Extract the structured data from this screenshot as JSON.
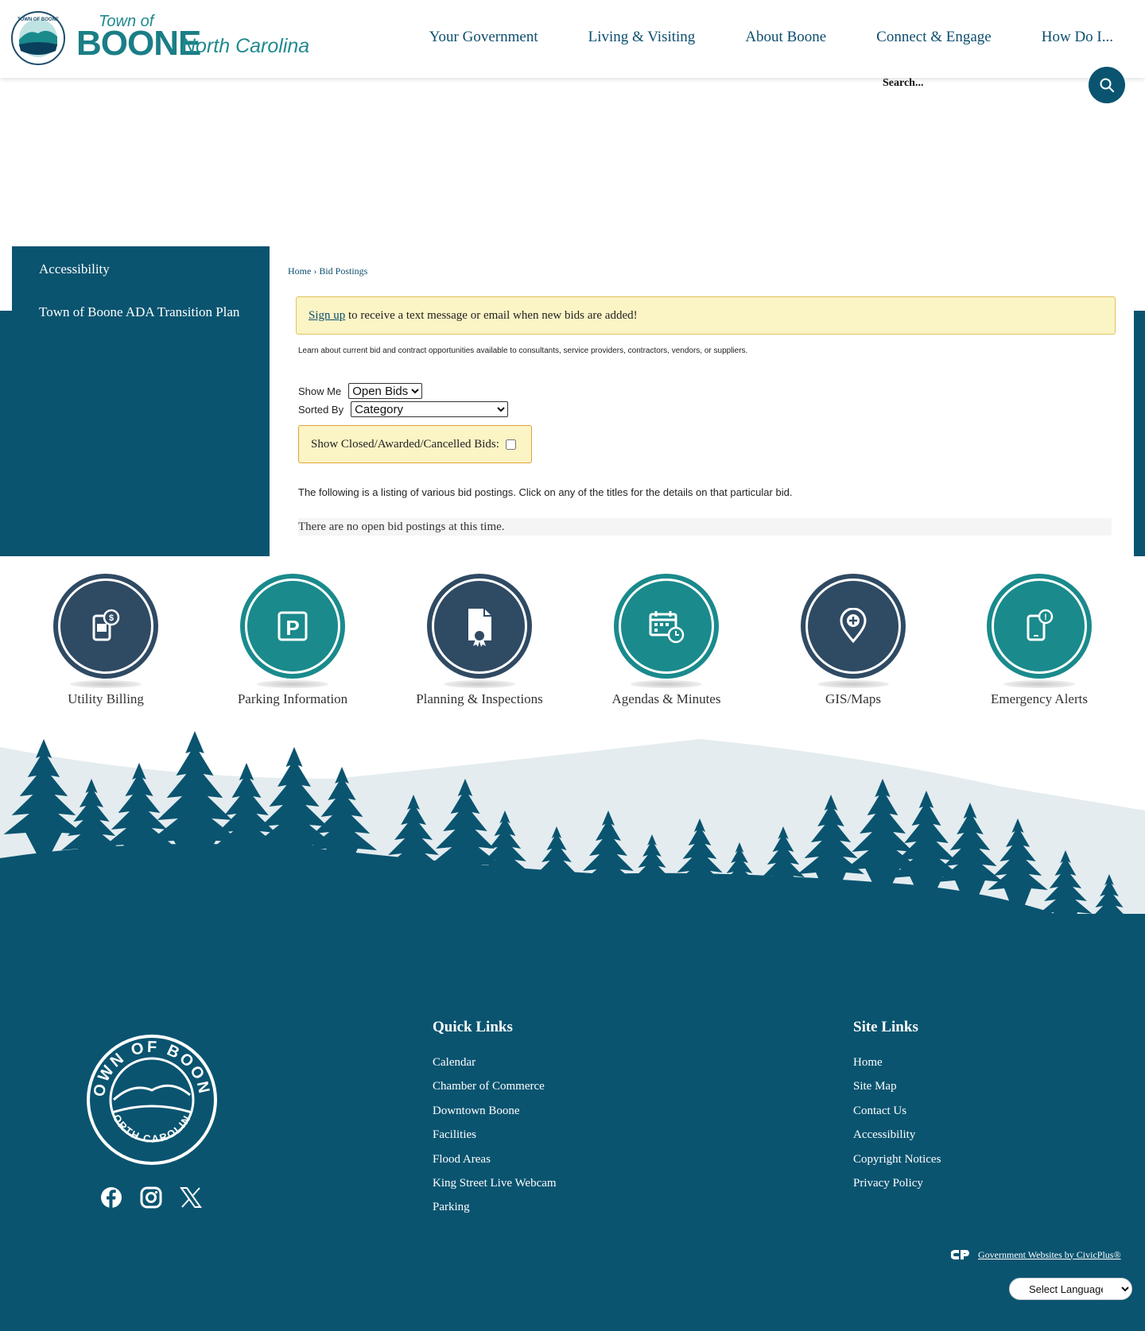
{
  "header": {
    "logo": {
      "town_of": "Town of",
      "boone": "BOONE",
      "state": "North Carolina"
    },
    "nav": [
      "Your Government",
      "Living & Visiting",
      "About Boone",
      "Connect & Engage",
      "How Do I..."
    ]
  },
  "search": {
    "placeholder": "Search..."
  },
  "sidebar": {
    "items": [
      "Accessibility",
      "Town of Boone ADA Transition Plan"
    ]
  },
  "main": {
    "breadcrumb": {
      "home": "Home",
      "separator": "›",
      "current": "Bid Postings"
    },
    "signup": {
      "link": "Sign up",
      "text": " to receive a text message or email when new bids are added!"
    },
    "intro": "Learn about current bid and contract opportunities available to consultants, service providers, contractors, vendors, or suppliers.",
    "show_me": {
      "label": "Show Me",
      "value": "Open Bids"
    },
    "sorted_by": {
      "label": "Sorted By",
      "value": "Category"
    },
    "closed_toggle": "Show Closed/Awarded/Cancelled Bids:",
    "listing_text": "The following is a listing of various bid postings. Click on any of the titles for the details on that particular bid.",
    "no_bids": "There are no open bid postings at this time."
  },
  "quick_links": [
    {
      "label": "Utility Billing",
      "icon": "utility-billing-icon",
      "color": "#2f4a63"
    },
    {
      "label": "Parking Information",
      "icon": "parking-icon",
      "color": "#1a8a8c"
    },
    {
      "label": "Planning & Inspections",
      "icon": "document-award-icon",
      "color": "#2f4a63"
    },
    {
      "label": "Agendas & Minutes",
      "icon": "calendar-clock-icon",
      "color": "#1a8a8c"
    },
    {
      "label": "GIS/Maps",
      "icon": "map-pin-icon",
      "color": "#2f4a63"
    },
    {
      "label": "Emergency Alerts",
      "icon": "phone-alert-icon",
      "color": "#1a8a8c"
    }
  ],
  "footer": {
    "seal": {
      "top": "TOWN OF BOONE",
      "bottom": "NORTH CAROLINA"
    },
    "quick_links_title": "Quick Links",
    "quick_links": [
      "Calendar",
      "Chamber of Commerce",
      "Downtown Boone",
      "Facilities",
      "Flood Areas",
      "King Street Live Webcam",
      "Parking"
    ],
    "site_links_title": "Site Links",
    "site_links": [
      "Home",
      "Site Map",
      "Contact Us",
      "Accessibility",
      "Copyright Notices",
      "Privacy Policy"
    ],
    "socials": [
      "facebook-icon",
      "instagram-icon",
      "x-icon"
    ],
    "civicplus": "Government Websites by CivicPlus®",
    "language": "Select Language"
  },
  "colors": {
    "primary": "#0a5470",
    "teal": "#1a8a8c",
    "dark": "#2f4a63",
    "alert_bg": "#fbf4c5"
  }
}
